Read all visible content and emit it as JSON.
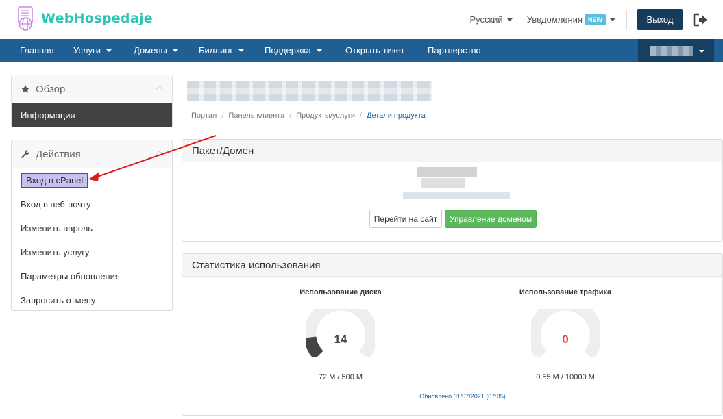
{
  "brand": {
    "name": "WebHospedaje",
    "accent": "#2ec4b6"
  },
  "header": {
    "language": "Русский",
    "notifications": "Уведомления",
    "notifications_badge": "NEW",
    "logout_label": "Выход",
    "exit_icon": "sign-out-icon"
  },
  "nav": {
    "items": [
      {
        "label": "Главная",
        "dropdown": false
      },
      {
        "label": "Услуги",
        "dropdown": true
      },
      {
        "label": "Домены",
        "dropdown": true
      },
      {
        "label": "Биллинг",
        "dropdown": true
      },
      {
        "label": "Поддержка",
        "dropdown": true
      },
      {
        "label": "Открыть тикет",
        "dropdown": false
      },
      {
        "label": "Партнерство",
        "dropdown": false
      }
    ],
    "color": "#1f5f94"
  },
  "sidebar": {
    "overview": {
      "title": "Обзор",
      "icon": "star-icon",
      "active_item": "Информация"
    },
    "actions": {
      "title": "Действия",
      "icon": "wrench-icon",
      "items": [
        "Вход в cPanel",
        "Вход в веб-почту",
        "Изменить пароль",
        "Изменить услугу",
        "Параметры обновления",
        "Запросить отмену"
      ]
    }
  },
  "breadcrumb": {
    "items": [
      "Портал",
      "Панель клиента",
      "Продукты/услуги"
    ],
    "active": "Детали продукта"
  },
  "package": {
    "title": "Пакет/Домен",
    "visit_button": "Перейти на сайт",
    "manage_button": "Управление доменом"
  },
  "usage": {
    "title": "Статистика использования",
    "disk": {
      "label": "Использование диска",
      "value": "14",
      "percent": 14,
      "sub": "72 M / 500 M"
    },
    "bandwidth": {
      "label": "Использование трафика",
      "value": "0",
      "percent": 0,
      "sub": "0.55 M / 10000 M"
    },
    "updated": "Обновлено 01/07/2021 (07:35)"
  }
}
